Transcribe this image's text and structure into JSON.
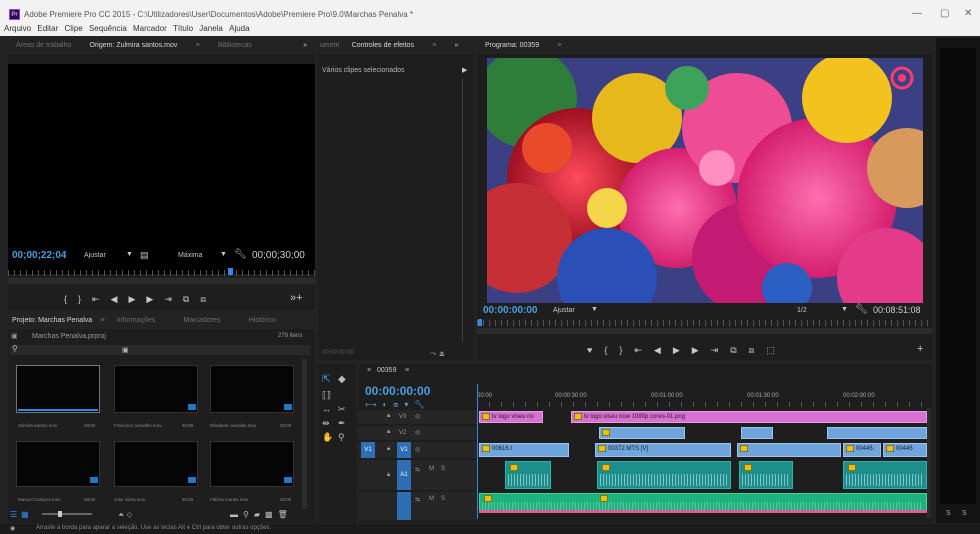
{
  "titlebar": {
    "title": "Adobe Premiere Pro CC 2015 - C:\\Utilizadores\\User\\Documentos\\Adobe\\Premiere Pro\\9.0\\Marchas Penalva *",
    "logo": "Pr",
    "min": "—",
    "max": "▢",
    "close": "✕"
  },
  "menu": [
    "Arquivo",
    "Editar",
    "Clipe",
    "Sequência",
    "Marcador",
    "Título",
    "Janela",
    "Ajuda"
  ],
  "source": {
    "tabs": [
      "Áreas de trabalho",
      "Origem: Zulmira santos.mov",
      "≡",
      "Bibliotecas",
      "»"
    ],
    "timecode": "00;00;22;04",
    "fit": "Ajustar",
    "quality": "Máxima",
    "duration": "00;00;30;00"
  },
  "effects": {
    "tabs": [
      "umetri",
      "Controles de efeitos",
      "≡",
      "»"
    ],
    "selected_text": "Vários clipes selecionados",
    "timecode": "00:00:00:00"
  },
  "program": {
    "tabs": [
      "Programa: 00359",
      "≡"
    ],
    "timecode": "00:00:00:00",
    "fit": "Ajustar",
    "resolution": "1/2",
    "duration": "00:08:51:08",
    "image_colors": {
      "pink": "#e8418a",
      "red": "#c41c2e",
      "yellow": "#e6b81c",
      "blue": "#2b5fc4",
      "green": "#2ea455"
    }
  },
  "project": {
    "tabs": [
      "Projeto: Marchas Penalva",
      "≡",
      "Informações",
      "Marcadores",
      "Histórico"
    ],
    "filename": "Marchas Penalva.prproj",
    "count": "279 itens",
    "items": [
      {
        "name": "Zulmira santos.mov",
        "dur": "30;00"
      },
      {
        "name": "Francisco carvalho.mov",
        "dur": "30;00"
      },
      {
        "name": "Elisabete carvalas.mov",
        "dur": "30;00"
      },
      {
        "name": "Manuel Campos.mov",
        "dur": "30;00"
      },
      {
        "name": "Jose vieira.mov",
        "dur": "30;00"
      },
      {
        "name": "Fátima morais.mov",
        "dur": "30;00"
      }
    ]
  },
  "timeline": {
    "tab": "00359",
    "timecode": "00:00:00:00",
    "ruler": [
      "00:00",
      "00:00:30:00",
      "00:01:00:00",
      "00:01:30:00",
      "00:02:00:00"
    ],
    "tracks": {
      "v3": "V3",
      "v2": "V2",
      "v1": "V1",
      "a1": "A1",
      "m": "M",
      "s": "S"
    },
    "clips": {
      "v3a": "tv logo viseu no",
      "v3b": "tv logo viseu now 1080p cores-01.png",
      "v1a": "00616.I",
      "v1b": "00372.MTS [V]",
      "v1c": "00445.",
      "v1d": "00445"
    }
  },
  "meters": {
    "s1": "S",
    "s2": "S"
  },
  "status": {
    "text": "Arraste a borda para aparar a seleção. Use as teclas Alt e Ctrl para obter outras opções."
  }
}
